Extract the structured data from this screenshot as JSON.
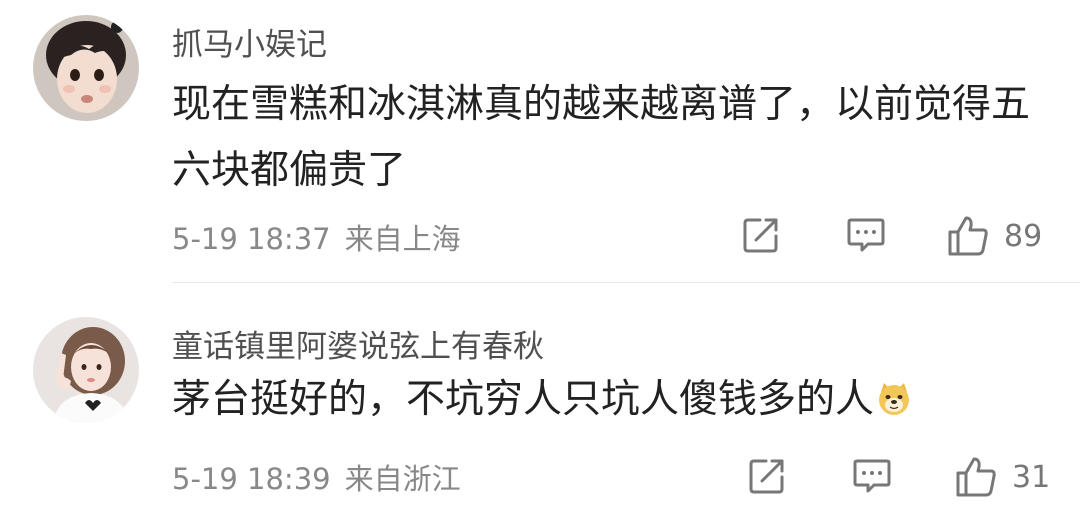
{
  "comments": [
    {
      "username": "抓马小娱记",
      "content": "现在雪糕和冰淇淋真的越来越离谱了，以前觉得五六块都偏贵了",
      "date": "5-19 18:37",
      "location": "来自上海",
      "likes": "89",
      "avatar_icon": "child-avatar-photo"
    },
    {
      "username": "童话镇里阿婆说弦上有春秋",
      "content": "茅台挺好的，不坑穷人只坑人傻钱多的人",
      "emoji": "doge-emoji",
      "date": "5-19 18:39",
      "location": "来自浙江",
      "likes": "31",
      "avatar_icon": "girl-avatar-photo"
    }
  ],
  "icons": {
    "share": "share-icon",
    "reply": "comment-icon",
    "like": "thumbs-up-icon"
  },
  "colors": {
    "text_primary": "#222222",
    "text_secondary": "#888888",
    "divider": "#e9e9e9"
  }
}
